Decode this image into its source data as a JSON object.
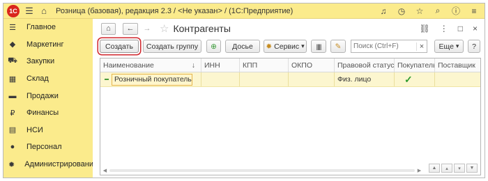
{
  "titlebar": {
    "logo": "1С",
    "title": "Розница (базовая), редакция 2.3 / <Не указан> / (1С:Предприятие)",
    "icons": [
      "menu-icon",
      "home-icon",
      "bell-icon",
      "history-icon",
      "star-icon",
      "search-icon",
      "info-icon",
      "settings-icon"
    ]
  },
  "sidebar": {
    "items": [
      {
        "label": "Главное",
        "icon": "menu-icon",
        "glyph": "☰"
      },
      {
        "label": "Маркетинг",
        "icon": "marketing-icon",
        "glyph": "◆"
      },
      {
        "label": "Закупки",
        "icon": "cart-icon",
        "glyph": "⛟"
      },
      {
        "label": "Склад",
        "icon": "warehouse-icon",
        "glyph": "▦"
      },
      {
        "label": "Продажи",
        "icon": "sales-icon",
        "glyph": "▬"
      },
      {
        "label": "Финансы",
        "icon": "finance-icon",
        "glyph": "₽"
      },
      {
        "label": "НСИ",
        "icon": "reference-icon",
        "glyph": "▤"
      },
      {
        "label": "Персонал",
        "icon": "person-icon",
        "glyph": "●"
      },
      {
        "label": "Администрирование",
        "icon": "gear-icon",
        "glyph": "✹"
      }
    ]
  },
  "header": {
    "title": "Контрагенты",
    "home_glyph": "⌂",
    "back_glyph": "←",
    "forward_glyph": "→",
    "star_glyph": "☆",
    "link_glyph": "🔗",
    "menu_glyph": "⋮",
    "maximize_glyph": "□",
    "close_glyph": "×"
  },
  "toolbar": {
    "create_label": "Создать",
    "create_group_label": "Создать группу",
    "add_copy_glyph": "⊕",
    "dossier_label": "Досье",
    "service_label": "Сервис",
    "dropdown_glyph": "▾",
    "barcode_glyph": "|||||",
    "edit_glyph": "✎",
    "search_placeholder": "Поиск (Ctrl+F)",
    "clear_glyph": "×",
    "more_label": "Еще",
    "help_label": "?"
  },
  "table": {
    "columns": [
      "Наименование",
      "ИНН",
      "КПП",
      "ОКПО",
      "Правовой статус",
      "Покупатель",
      "Поставщик"
    ],
    "sort_glyph": "↓",
    "rows": [
      {
        "name": "Розничный покупатель",
        "inn": "",
        "kpp": "",
        "okpo": "",
        "status": "Физ. лицо",
        "buyer_check": "✓",
        "supplier": ""
      }
    ]
  },
  "colors": {
    "accent_yellow": "#fbeb8c",
    "selected_row": "#fcf6cf",
    "create_highlight": "#d0262c",
    "check_green": "#2e9b2e"
  }
}
